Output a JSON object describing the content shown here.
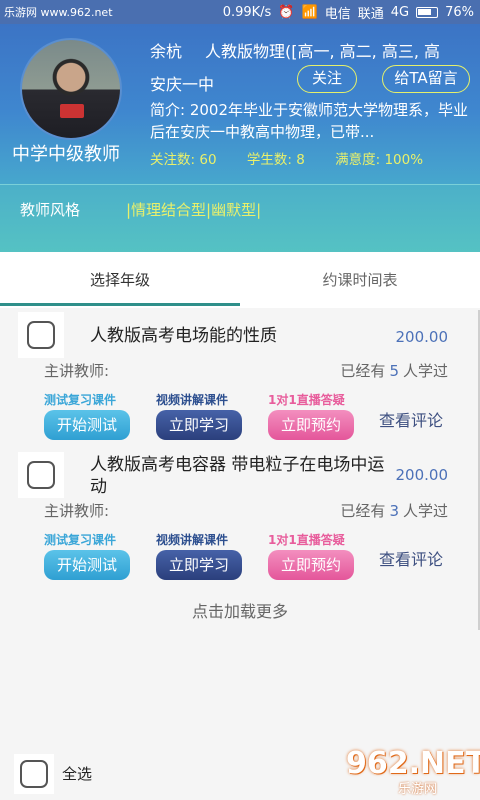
{
  "status_bar": {
    "watermark": "乐游网 www.962.net",
    "speed": "0.99K/s",
    "carrier1": "电信",
    "carrier2": "联通",
    "network": "4G",
    "battery": "76%"
  },
  "teacher": {
    "name": "余杭",
    "subject": "人教版物理([高一, 高二, 高三, 高",
    "school": "安庆一中",
    "level": "中学中级教师",
    "follow_label": "关注",
    "message_label": "给TA留言",
    "intro": "简介: 2002年毕业于安徽师范大学物理系，毕业后在安庆一中教高中物理，已带...",
    "stats": {
      "follows_label": "关注数:",
      "follows": "60",
      "students_label": "学生数:",
      "students": "8",
      "satisfaction_label": "满意度:",
      "satisfaction": "100%"
    },
    "style_label": "教师风格",
    "style_value": "|情理结合型|幽默型|"
  },
  "tabs": [
    {
      "label": "选择年级"
    },
    {
      "label": "约课时间表"
    }
  ],
  "courses": [
    {
      "title": "人教版高考电场能的性质",
      "price": "200.00",
      "lecturer_label": "主讲教师:",
      "learned_prefix": "已经有",
      "learned_count": "5",
      "learned_suffix": "人学过",
      "caption1": "测试复习课件",
      "caption2": "视频讲解课件",
      "caption3": "1对1直播答疑",
      "btn1": "开始测试",
      "btn2": "立即学习",
      "btn3": "立即预约",
      "review": "查看评论"
    },
    {
      "title": "人教版高考电容器 带电粒子在电场中运动",
      "price": "200.00",
      "lecturer_label": "主讲教师:",
      "learned_prefix": "已经有",
      "learned_count": "3",
      "learned_suffix": "人学过",
      "caption1": "测试复习课件",
      "caption2": "视频讲解课件",
      "caption3": "1对1直播答疑",
      "btn1": "开始测试",
      "btn2": "立即学习",
      "btn3": "立即预约",
      "review": "查看评论"
    }
  ],
  "load_more": "点击加载更多",
  "select_all": "全选",
  "watermark_logo": {
    "big": "962.NET",
    "small": "乐游网"
  },
  "colors": {
    "accent": "#4c71b8",
    "highlight": "#e9f06b",
    "tab_indicator": "#2f8f8a"
  }
}
